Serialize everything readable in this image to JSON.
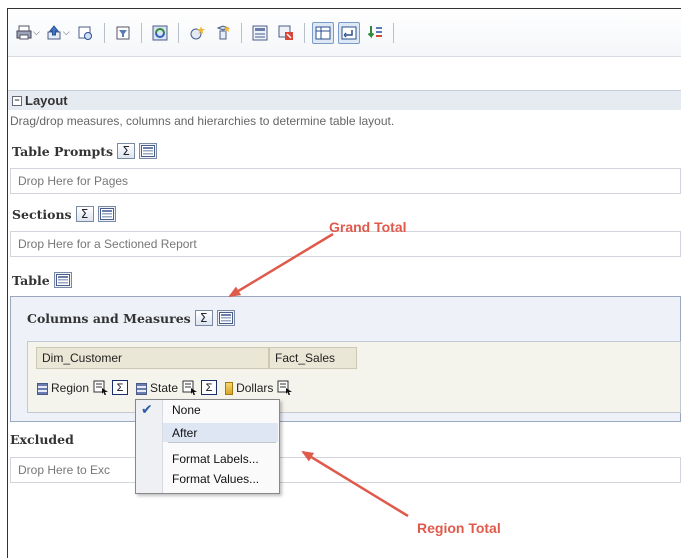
{
  "toolbar": {
    "icons": [
      "print-icon",
      "export-icon",
      "view-icon",
      "filter-icon",
      "refresh-icon",
      "new-calc-icon",
      "edit-formula-icon",
      "pivot-icon",
      "column-props-icon",
      "table-layout-icon",
      "freeze-icon",
      "sort-icon"
    ]
  },
  "layout": {
    "title": "Layout",
    "hint": "Drag/drop measures, columns and hierarchies to determine table layout."
  },
  "table_prompts": {
    "title": "Table Prompts",
    "drop_text": "Drop Here for Pages"
  },
  "sections": {
    "title": "Sections",
    "drop_text": "Drop Here for a Sectioned Report"
  },
  "table": {
    "title": "Table",
    "columns_measures_title": "Columns and Measures",
    "groups": [
      {
        "name": "Dim_Customer"
      },
      {
        "name": "Fact_Sales"
      }
    ],
    "items": [
      {
        "label": "Region"
      },
      {
        "label": "State"
      },
      {
        "label": "Dollars"
      }
    ]
  },
  "excluded": {
    "title": "Excluded",
    "drop_text": "Drop Here to Exc"
  },
  "context_menu": {
    "items": [
      "None",
      "After",
      "Format Labels...",
      "Format Values..."
    ],
    "checked": "None",
    "hovered": "After"
  },
  "annotations": {
    "grand_total": "Grand Total",
    "region_total": "Region Total",
    "color": "#e05a4c"
  }
}
